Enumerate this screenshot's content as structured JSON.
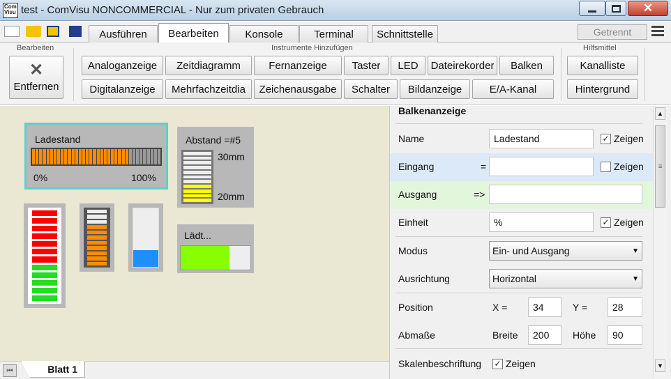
{
  "window": {
    "app_icon_text": "Com Visu",
    "title": "test - ComVisu NONCOMMERCIAL - Nur zum privaten Gebrauch",
    "min_icon": "minimize-icon",
    "max_icon": "maximize-icon",
    "close_icon": "close-icon"
  },
  "tabs": [
    {
      "label": "Ausführen",
      "active": false
    },
    {
      "label": "Bearbeiten",
      "active": true
    },
    {
      "label": "Konsole",
      "active": false
    },
    {
      "label": "Terminal",
      "active": false
    },
    {
      "label": "Schnittstelle",
      "active": false
    }
  ],
  "status": "Getrennt",
  "ribbon": {
    "group_bearbeiten": "Bearbeiten",
    "remove_label": "Entfernen",
    "group_instruments": "Instrumente Hinzufügen",
    "group_tools": "Hilfsmittel",
    "row1": [
      "Analoganzeige",
      "Zeitdiagramm",
      "Fernanzeige",
      "Taster",
      "LED",
      "Dateirekorder",
      "Balken"
    ],
    "row2": [
      "Digitalanzeige",
      "Mehrfachzeitdia",
      "Zeichenausgabe",
      "Schalter",
      "Bildanzeige",
      "E/A-Kanal"
    ],
    "tools": [
      "Kanalliste",
      "Hintergrund"
    ]
  },
  "widgets": {
    "ladestand": {
      "title": "Ladestand",
      "min": "0%",
      "max": "100%",
      "level": 0.75
    },
    "abstand": {
      "title": "Abstand =#5",
      "top": "30mm",
      "bottom": "20mm"
    },
    "laedt": {
      "title": "Lädt...",
      "level": 0.7
    }
  },
  "sheet": {
    "label": "Blatt 1"
  },
  "props": {
    "header": "Balkenanzeige",
    "name_label": "Name",
    "name_value": "Ladestand",
    "zeigen": "Zeigen",
    "eingang_label": "Eingang",
    "eingang_op": "=",
    "ausgang_label": "Ausgang",
    "ausgang_op": "=>",
    "einheit_label": "Einheit",
    "einheit_value": "%",
    "modus_label": "Modus",
    "modus_value": "Ein- und Ausgang",
    "ausrichtung_label": "Ausrichtung",
    "ausrichtung_value": "Horizontal",
    "position_label": "Position",
    "x_label": "X =",
    "x_value": "34",
    "y_label": "Y =",
    "y_value": "28",
    "abmasse_label": "Abmaße",
    "breite_label": "Breite",
    "breite_value": "200",
    "hoehe_label": "Höhe",
    "hoehe_value": "90",
    "skalen_label": "Skalenbeschriftung"
  },
  "colors": {
    "accent_orange": "#ff8c00",
    "led_red": "#ff0000",
    "led_green": "#22dd22",
    "blue": "#1e8fff",
    "lime": "#88ff00",
    "yellow": "#ffff00",
    "selection": "#66cccc"
  }
}
